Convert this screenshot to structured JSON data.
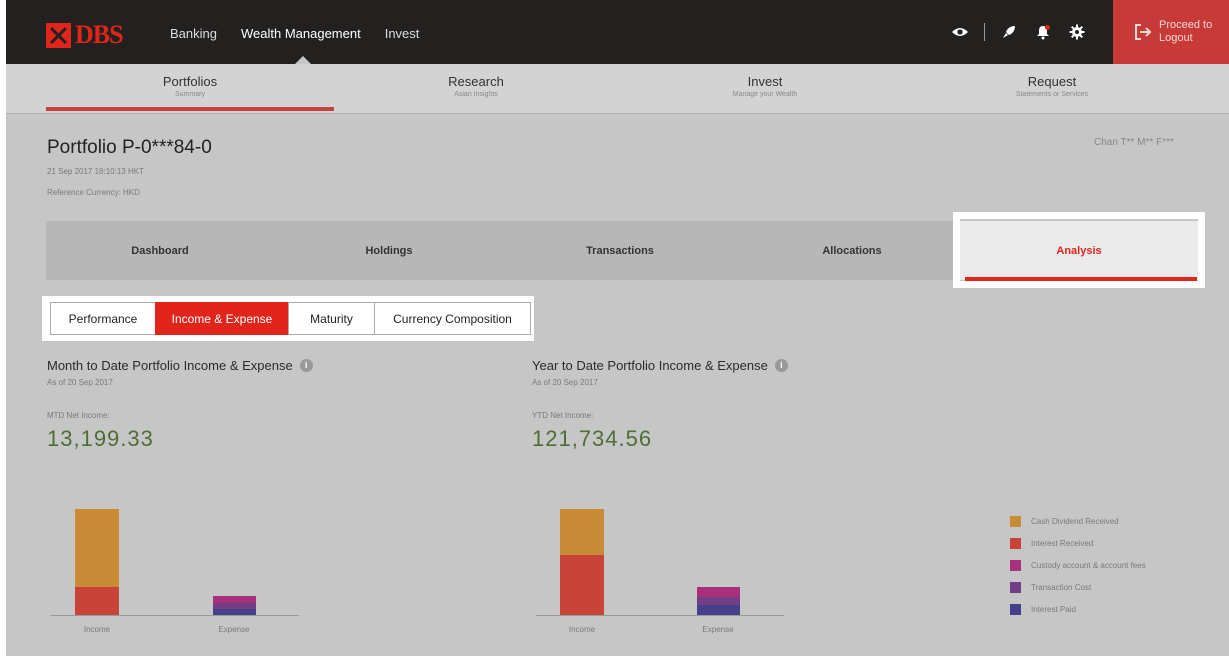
{
  "topbar": {
    "logo_text": "DBS",
    "nav": [
      "Banking",
      "Wealth Management",
      "Invest"
    ],
    "active_nav": "Wealth Management",
    "icons": [
      "eye-icon",
      "rocket-icon",
      "bell-icon",
      "gear-icon"
    ],
    "logout_line1": "Proceed to",
    "logout_line2": "Logout"
  },
  "main_nav": [
    {
      "title": "Portfolios",
      "subtitle": "Summary"
    },
    {
      "title": "Research",
      "subtitle": "Asian Insights"
    },
    {
      "title": "Invest",
      "subtitle": "Manage your Wealth"
    },
    {
      "title": "Request",
      "subtitle": "Statements or Services"
    }
  ],
  "portfolio": {
    "title": "Portfolio P-0***84-0",
    "datetime": "21 Sep 2017 18:10:13 HKT",
    "reference_currency": "Reference Currency: HKD",
    "user": "Chan T** M** F***"
  },
  "tabs": [
    "Dashboard",
    "Holdings",
    "Transactions",
    "Allocations",
    "Analysis"
  ],
  "active_tab": "Analysis",
  "subtabs": [
    "Performance",
    "Income & Expense",
    "Maturity",
    "Currency Composition"
  ],
  "active_subtab": "Income & Expense",
  "mtd": {
    "title": "Month to Date Portfolio Income & Expense",
    "as_of": "As of 20 Sep 2017",
    "net_label": "MTD Net Income:",
    "net_value": "13,199.33"
  },
  "ytd": {
    "title": "Year to Date Portfolio Income & Expense",
    "as_of": "As of 20 Sep 2017",
    "net_label": "YTD Net Income:",
    "net_value": "121,734.56"
  },
  "charts": {
    "categories": [
      "Income",
      "Expense"
    ],
    "legend": [
      {
        "label": "Cash Dividend Received",
        "color": "#c98b35"
      },
      {
        "label": "Interest Received",
        "color": "#c94438"
      },
      {
        "label": "Custody account & account fees",
        "color": "#a9307a"
      },
      {
        "label": "Transaction Cost",
        "color": "#743e86"
      },
      {
        "label": "Interest Paid",
        "color": "#46408a"
      }
    ]
  }
}
